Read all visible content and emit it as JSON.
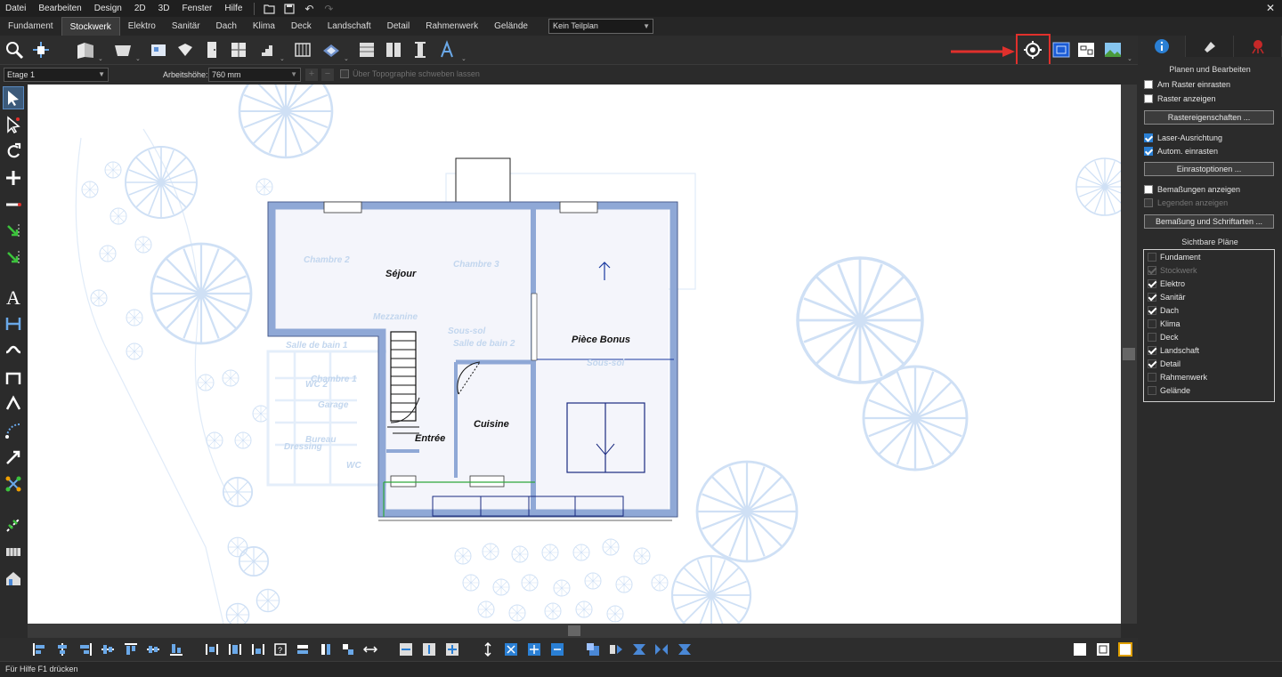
{
  "menu": [
    "Datei",
    "Bearbeiten",
    "Design",
    "2D",
    "3D",
    "Fenster",
    "Hilfe"
  ],
  "tabs": [
    "Fundament",
    "Stockwerk",
    "Elektro",
    "Sanitär",
    "Dach",
    "Klima",
    "Deck",
    "Landschaft",
    "Detail",
    "Rahmenwerk",
    "Gelände"
  ],
  "active_tab": "Stockwerk",
  "teilplan": "Kein Teilplan",
  "toolbar2": {
    "etage": "Etage 1",
    "arbeitshoehe_label": "Arbeitshöhe:",
    "arbeitshoehe_value": "760 mm",
    "topo_label": "Über Topographie schweben lassen"
  },
  "plan": {
    "rooms": [
      "Séjour",
      "Pièce Bonus",
      "Cuisine",
      "Entrée"
    ],
    "ghost_labels": [
      "Chambre 2",
      "Chambre 3",
      "Mezzanine",
      "Sous-sol",
      "Salle de bain 2",
      "Salle de bain 1",
      "WC 2",
      "Chambre 1",
      "Garage",
      "Bureau",
      "Dressing",
      "WC",
      "Sous-sol"
    ]
  },
  "right_panel": {
    "section_title": "Planen und Bearbeiten",
    "am_raster": "Am Raster einrasten",
    "raster_anzeigen": "Raster anzeigen",
    "rastereigenschaften": "Rastereigenschaften ...",
    "laser": "Laser-Ausrichtung",
    "autom": "Autom. einrasten",
    "einrastoptionen": "Einrastoptionen ...",
    "bemassungen": "Bemaßungen anzeigen",
    "legenden": "Legenden anzeigen",
    "bemassung_schrift": "Bemaßung und Schriftarten ...",
    "sichtbare_title": "Sichtbare Pläne",
    "plans": [
      {
        "name": "Fundament",
        "checked": false,
        "disabled": false
      },
      {
        "name": "Stockwerk",
        "checked": true,
        "disabled": true
      },
      {
        "name": "Elektro",
        "checked": true,
        "disabled": false
      },
      {
        "name": "Sanitär",
        "checked": true,
        "disabled": false
      },
      {
        "name": "Dach",
        "checked": true,
        "disabled": false
      },
      {
        "name": "Klima",
        "checked": false,
        "disabled": false
      },
      {
        "name": "Deck",
        "checked": false,
        "disabled": false
      },
      {
        "name": "Landschaft",
        "checked": true,
        "disabled": false
      },
      {
        "name": "Detail",
        "checked": true,
        "disabled": false
      },
      {
        "name": "Rahmenwerk",
        "checked": false,
        "disabled": false
      },
      {
        "name": "Gelände",
        "checked": false,
        "disabled": false
      }
    ]
  },
  "status": "Für Hilfe F1 drücken",
  "colors": {
    "accent": "#2a7fd4",
    "highlight": "#e0302c",
    "wall": "#8fa8d6",
    "floor": "#f3f4fb"
  }
}
